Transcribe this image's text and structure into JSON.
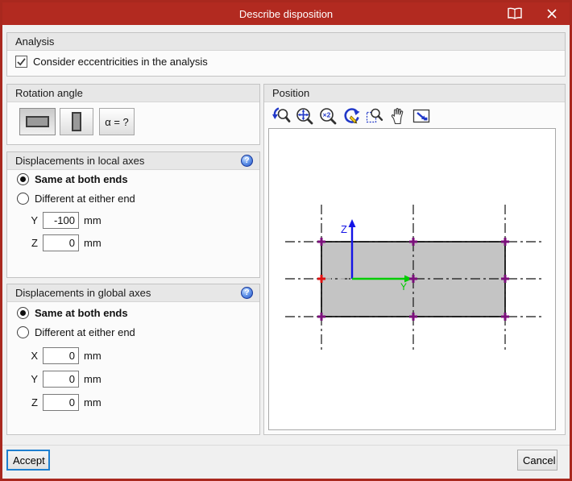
{
  "window": {
    "title": "Describe disposition"
  },
  "icons": {
    "help_glyph": "?",
    "titlebar": [
      "book-icon",
      "close-icon"
    ]
  },
  "analysis": {
    "header": "Analysis",
    "checkbox": {
      "label": "Consider eccentricities in the analysis",
      "checked": true
    }
  },
  "rotation": {
    "header": "Rotation angle",
    "buttons": [
      {
        "name": "orientation-horizontal",
        "selected": true
      },
      {
        "name": "orientation-vertical",
        "selected": false
      },
      {
        "name": "angle-custom",
        "label": "α = ?",
        "selected": false
      }
    ]
  },
  "local_axes": {
    "header": "Displacements in local axes",
    "option_same": "Same at both ends",
    "option_diff": "Different at either end",
    "selected_option": "Same at both ends",
    "fields": [
      {
        "label": "Y",
        "value": "-100",
        "unit": "mm"
      },
      {
        "label": "Z",
        "value": "0",
        "unit": "mm"
      }
    ]
  },
  "global_axes": {
    "header": "Displacements in global axes",
    "option_same": "Same at both ends",
    "option_diff": "Different at either end",
    "selected_option": "Same at both ends",
    "fields": [
      {
        "label": "X",
        "value": "0",
        "unit": "mm"
      },
      {
        "label": "Y",
        "value": "0",
        "unit": "mm"
      },
      {
        "label": "Z",
        "value": "0",
        "unit": "mm"
      }
    ]
  },
  "position": {
    "header": "Position",
    "toolbar": [
      "zoom-previous",
      "zoom-extents",
      "zoom-x2",
      "redraw",
      "zoom-window",
      "pan",
      "fit-to-window"
    ],
    "drawing": {
      "axis_labels": {
        "vertical": "Z",
        "horizontal": "Y"
      },
      "axis_colors": {
        "z": "#1414E6",
        "y": "#00CC00"
      },
      "section_fill": "#C4C4C4",
      "anchor_marker_color": "#7B107B",
      "selected_anchor_color": "#E01010",
      "selected_anchor": "middle-left",
      "anchor_grid": [
        "top-left",
        "top-center",
        "top-right",
        "middle-left",
        "middle-center",
        "middle-right",
        "bottom-left",
        "bottom-center",
        "bottom-right"
      ]
    }
  },
  "footer": {
    "accept_label": "Accept",
    "cancel_label": "Cancel"
  },
  "colors": {
    "titlebar": "#B22A20",
    "accent_focus": "#1E7FD0"
  }
}
